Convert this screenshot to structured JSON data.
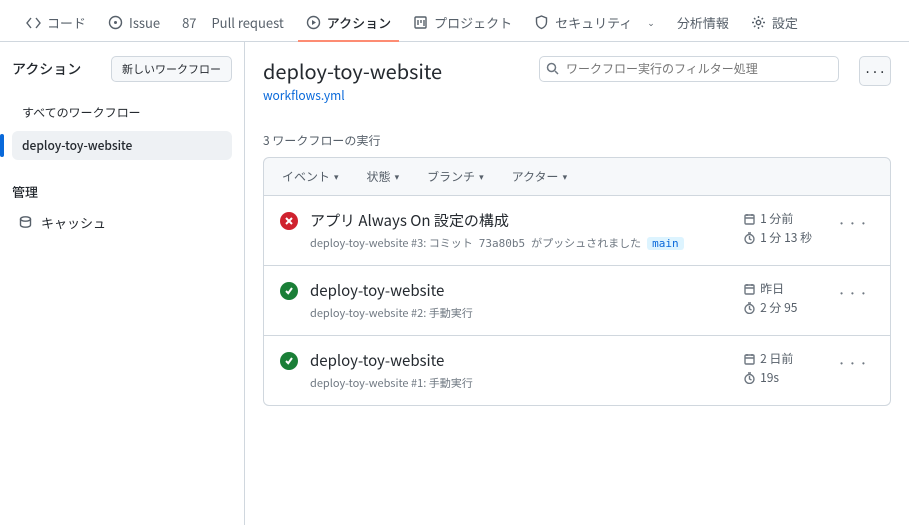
{
  "nav": {
    "code": "コード",
    "issues": "Issue",
    "pulls_count": "87",
    "pulls": "Pull request",
    "actions": "アクション",
    "projects": "プロジェクト",
    "security": "セキュリティ",
    "insights": "分析情報",
    "settings": "設定"
  },
  "sidebar": {
    "title": "アクション",
    "new_btn": "新しいワークフロー",
    "all": "すべてのワークフロー",
    "wf": "deploy-toy-website",
    "manage": "管理",
    "cache": "キャッシュ"
  },
  "header": {
    "title": "deploy-toy-website",
    "file": "workflows.yml",
    "search_placeholder": "ワークフロー実行のフィルター処理"
  },
  "runs_count": "3 ワークフローの実行",
  "filters": {
    "event": "イベント",
    "status": "状態",
    "branch": "ブランチ",
    "actor": "アクター"
  },
  "runs": [
    {
      "status": "fail",
      "title": "アプリ Always On 設定の構成",
      "wf": "deploy-toy-website",
      "num": "#3",
      "meta1": ": コミット ",
      "hash": "73a80b5",
      "meta2": " がプッシュされました",
      "branch": "main",
      "when": "1 分前",
      "dur": "1 分 13 秒"
    },
    {
      "status": "ok",
      "title": "deploy-toy-website",
      "wf": "deploy-toy-website",
      "num": "#2",
      "meta1": ": 手動実行",
      "hash": "",
      "meta2": "",
      "branch": "",
      "when": "昨日",
      "dur": "2 分 95"
    },
    {
      "status": "ok",
      "title": "deploy-toy-website",
      "wf": "deploy-toy-website",
      "num": "#1",
      "meta1": ": 手動実行",
      "hash": "",
      "meta2": "",
      "branch": "",
      "when": "2 日前",
      "dur": "19s"
    }
  ]
}
